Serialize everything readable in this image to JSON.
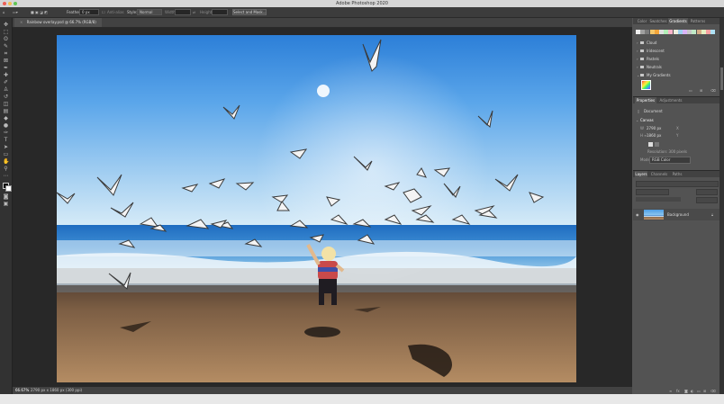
{
  "window": {
    "title": "Adobe Photoshop 2020"
  },
  "options_bar": {
    "feather_label": "Feather:",
    "feather_value": "0 px",
    "anti_alias_label": "Anti-alias",
    "style_label": "Style:",
    "style_value": "Normal",
    "width_label": "Width:",
    "height_label": "Height:",
    "select_mask_button": "Select and Mask..."
  },
  "document": {
    "tab_label": "Rainbow overlay.psd @ 66.7% (RGB/8)"
  },
  "status_bar": {
    "zoom": "66.67%",
    "doc_info": "2790 px x 1860 px (300 ppi)"
  },
  "gradients_panel": {
    "tabs": [
      "Color",
      "Swatches",
      "Gradients",
      "Patterns"
    ],
    "active_tab": "Gradients",
    "groups": [
      "Cloud",
      "Iridescent",
      "Pastels",
      "Neutrals",
      "My Gradients"
    ],
    "swatch_colors": [
      "#f0f0f0",
      "#a0a0a0",
      "#7a7a7a",
      "#f5c86b",
      "#f3a53a",
      "#e0e0e0",
      "#b2eeb7",
      "#f9b3c9",
      "#eeeedd",
      "#9dd1f0",
      "#d9b3f5",
      "#c7c7c7",
      "#bfe9c6",
      "#d6ae87",
      "#e5f0c2",
      "#f6a1a1",
      "#aee1f5"
    ]
  },
  "properties_panel": {
    "tabs": [
      "Properties",
      "Adjustments"
    ],
    "doc_label": "Document",
    "canvas_section": "Canvas",
    "w_label": "W",
    "w_value": "2790 px",
    "h_label": "H",
    "h_value": "1860 px",
    "x_label": "X",
    "y_label": "Y",
    "resolution": "Resolution: 300 pixels",
    "mode_label": "Mode",
    "mode_value": "RGB Color"
  },
  "layers_panel": {
    "tabs": [
      "Layers",
      "Channels",
      "Paths"
    ],
    "layer_name": "Background"
  },
  "colors": {
    "app_bg": "#535353",
    "workspace_bg": "#282828",
    "accent": "#3d7cd1"
  }
}
